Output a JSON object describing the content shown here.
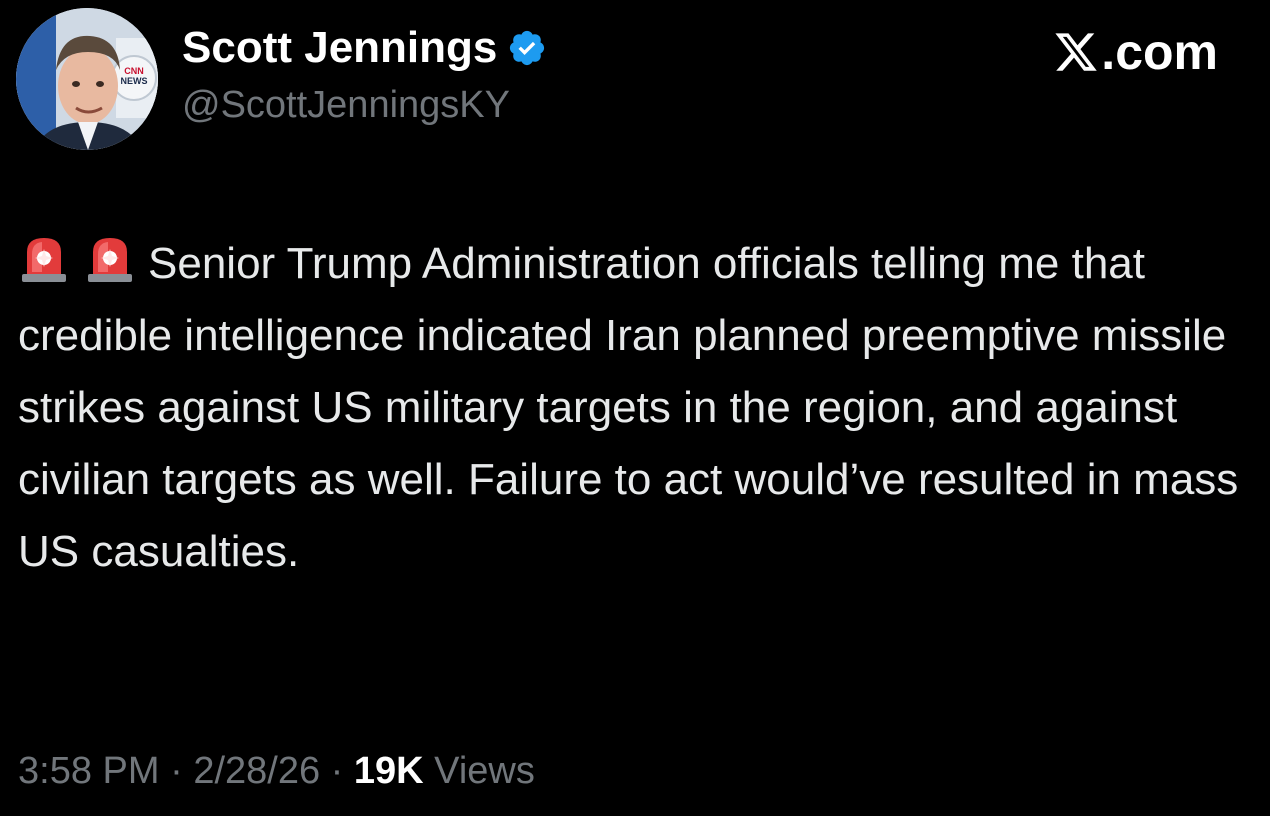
{
  "author": {
    "display_name": "Scott Jennings",
    "handle": "@ScottJenningsKY",
    "verified": true,
    "verified_color": "#1d9bf0"
  },
  "brand": {
    "label": ".com",
    "logo_icon": "x-logo-icon"
  },
  "tweet": {
    "emoji": [
      "rotating-light-icon",
      "rotating-light-icon"
    ],
    "text": "Senior Trump Administration officials telling me that credible intelligence indicated Iran planned preemptive missile strikes against US military targets in the region, and against civilian targets as well. Failure to act would’ve resulted in mass US casualties."
  },
  "meta": {
    "time": "3:58 PM",
    "separator": "·",
    "date": "2/28/26",
    "views_count": "19K",
    "views_label": "Views"
  },
  "colors": {
    "background": "#000000",
    "text_primary": "#e7e9ea",
    "text_secondary": "#71767b"
  }
}
